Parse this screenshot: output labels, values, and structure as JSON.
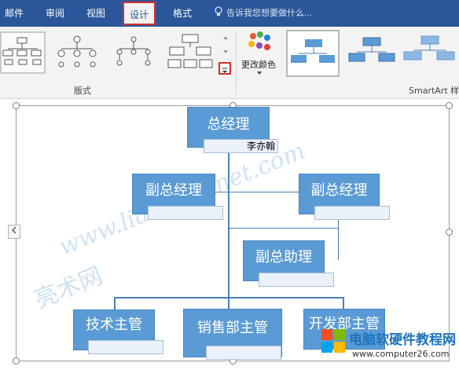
{
  "tabs": [
    {
      "label": "邮件"
    },
    {
      "label": "审阅"
    },
    {
      "label": "视图"
    },
    {
      "label": "设计"
    },
    {
      "label": "格式"
    }
  ],
  "tell_me": {
    "placeholder": "告诉我您想要做什么..."
  },
  "ribbon": {
    "layout_group_label": "版式",
    "change_colors_label": "更改颜色",
    "smartart_group_label": "SmartArt 样"
  },
  "org_chart": {
    "root": {
      "title": "总经理",
      "name": "李亦翰"
    },
    "vp_left": {
      "title": "副总经理",
      "name": ""
    },
    "vp_right": {
      "title": "副总经理",
      "name": ""
    },
    "assistant": {
      "title": "副总助理",
      "name": ""
    },
    "managers": [
      {
        "title": "技术主管",
        "name": ""
      },
      {
        "title": "销售部主管",
        "name": ""
      },
      {
        "title": "开发部主管",
        "name": ""
      }
    ]
  },
  "watermark": {
    "text": "www.liangshunet.com",
    "chars": "亮术网"
  },
  "brand": {
    "title": "电脑软硬件教程网",
    "url": "www.computer26.com"
  },
  "colors": {
    "accent": "#2b579a",
    "node": "#5b9bd5",
    "highlight": "#d9302b"
  }
}
